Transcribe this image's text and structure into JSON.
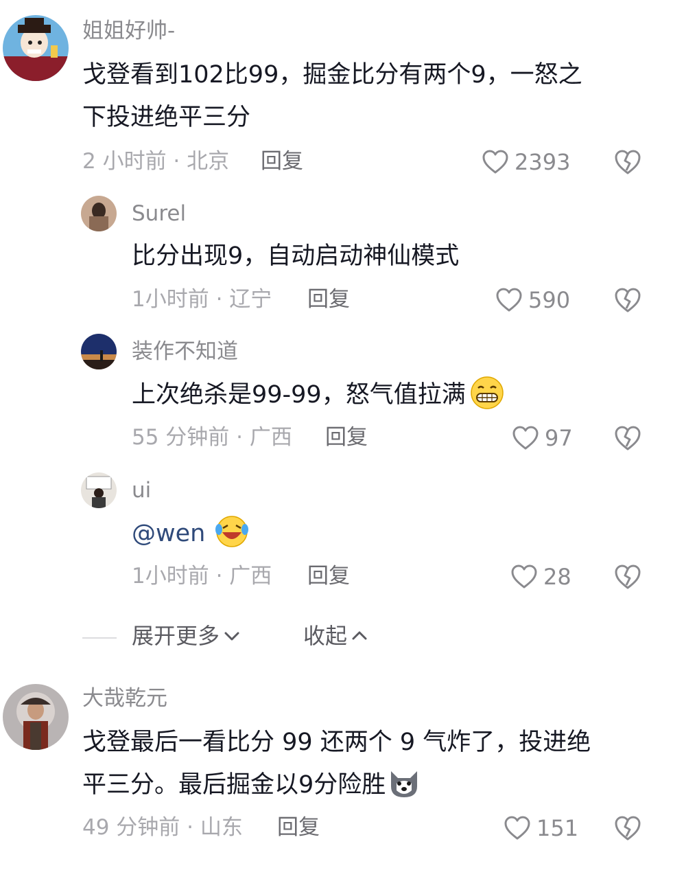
{
  "comments": [
    {
      "username": "姐姐好帅-",
      "content_lines": [
        "戈登看到102比99，掘金比分有两个9，一怒之",
        "下投进绝平三分"
      ],
      "meta": "2 小时前 · 北京",
      "reply_label": "回复",
      "likes": "2393",
      "avatar_icon": "cartoon-avatar"
    },
    {
      "username": "Surel",
      "content_lines": [
        "比分出现9，自动启动神仙模式"
      ],
      "meta": "1小时前 · 辽宁",
      "reply_label": "回复",
      "likes": "590",
      "avatar_icon": "photo-avatar"
    },
    {
      "username": "装作不知道",
      "content_lines": [
        "上次绝杀是99-99，怒气值拉满"
      ],
      "emoji": "grinning-emoji",
      "meta": "55 分钟前 · 广西",
      "reply_label": "回复",
      "likes": "97",
      "avatar_icon": "landscape-avatar"
    },
    {
      "username": "ui",
      "content_lines": [
        "@wen"
      ],
      "emoji": "laughing-tears-emoji",
      "meta": "1小时前 · 广西",
      "reply_label": "回复",
      "likes": "28",
      "avatar_icon": "photo-avatar"
    },
    {
      "username": "大哉乾元",
      "content_lines": [
        "戈登最后一看比分 99 还两个 9 气炸了，投进绝",
        "平三分。最后掘金以9分险胜"
      ],
      "emoji": "husky-emoji",
      "meta": "49 分钟前 · 山东",
      "reply_label": "回复",
      "likes": "151",
      "avatar_icon": "warrior-avatar"
    }
  ],
  "thread_controls": {
    "expand_label": "展开更多",
    "collapse_label": "收起"
  },
  "icons": {
    "like": "heart-outline-icon",
    "dislike": "broken-heart-icon",
    "expand": "chevron-down-icon",
    "collapse": "chevron-up-icon"
  },
  "colors": {
    "text": "#161823",
    "secondary": "#a8a8ad",
    "mention": "#2f4a7a"
  }
}
